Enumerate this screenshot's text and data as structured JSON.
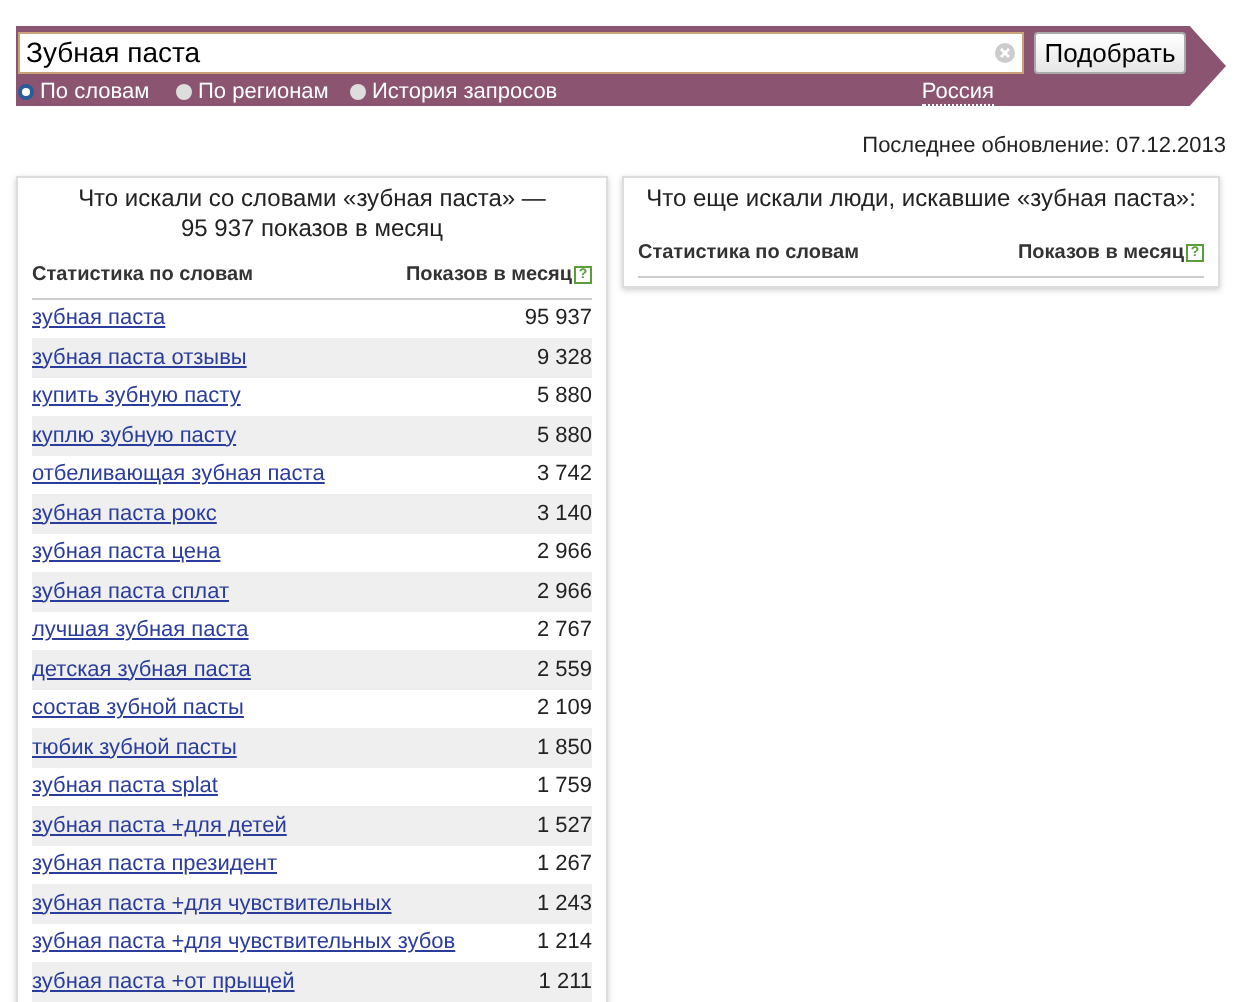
{
  "search": {
    "value": "Зубная паста",
    "button": "Подобрать"
  },
  "modes": [
    {
      "label": "По словам",
      "selected": true
    },
    {
      "label": "По регионам",
      "selected": false
    },
    {
      "label": "История запросов",
      "selected": false
    }
  ],
  "region": "Россия",
  "last_update": "Последнее обновление: 07.12.2013",
  "left_panel": {
    "title": "Что искали со словами «зубная паста» — 95 937 показов в месяц",
    "columns": [
      "Статистика по словам",
      "Показов в месяц"
    ],
    "help": "?",
    "rows": [
      {
        "phrase": "зубная паста",
        "count": "95 937"
      },
      {
        "phrase": "зубная паста отзывы",
        "count": "9 328"
      },
      {
        "phrase": "купить зубную пасту",
        "count": "5 880"
      },
      {
        "phrase": "куплю зубную пасту",
        "count": "5 880"
      },
      {
        "phrase": "отбеливающая зубная паста",
        "count": "3 742"
      },
      {
        "phrase": "зубная паста рокс",
        "count": "3 140"
      },
      {
        "phrase": "зубная паста цена",
        "count": "2 966"
      },
      {
        "phrase": "зубная паста сплат",
        "count": "2 966"
      },
      {
        "phrase": "лучшая зубная паста",
        "count": "2 767"
      },
      {
        "phrase": "детская зубная паста",
        "count": "2 559"
      },
      {
        "phrase": "состав зубной пасты",
        "count": "2 109"
      },
      {
        "phrase": "тюбик зубной пасты",
        "count": "1 850"
      },
      {
        "phrase": "зубная паста splat",
        "count": "1 759"
      },
      {
        "phrase": "зубная паста +для детей",
        "count": "1 527"
      },
      {
        "phrase": "зубная паста президент",
        "count": "1 267"
      },
      {
        "phrase": "зубная паста +для чувствительных",
        "count": "1 243"
      },
      {
        "phrase": "зубная паста +для чувствительных зубов",
        "count": "1 214"
      },
      {
        "phrase": "зубная паста +от прыщей",
        "count": "1 211"
      }
    ]
  },
  "right_panel": {
    "title": "Что еще искали люди, искавшие «зубная паста»:",
    "columns": [
      "Статистика по словам",
      "Показов в месяц"
    ],
    "help": "?"
  }
}
